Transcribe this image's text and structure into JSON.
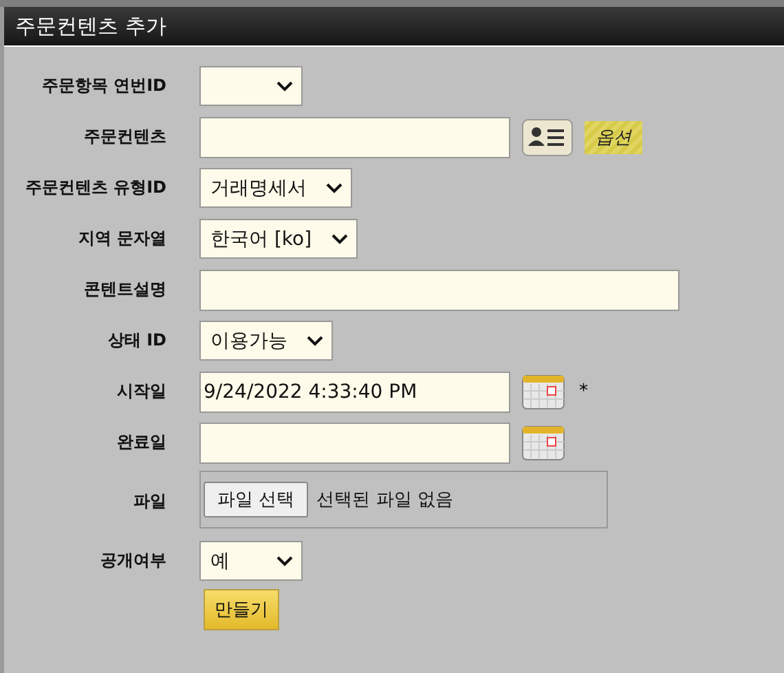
{
  "window": {
    "title": "주문컨텐츠 추가"
  },
  "fields": [
    {
      "label": "주문항목 연번ID",
      "kind": "select"
    },
    {
      "label": "주문컨텐츠",
      "kind": "text",
      "lookup": true,
      "option_tag": "옵션"
    },
    {
      "label": "주문컨텐츠 유형ID",
      "kind": "select",
      "value": "거래명세서"
    },
    {
      "label": "지역 문자열",
      "kind": "select",
      "value": "한국어 [ko]"
    },
    {
      "label": "콘텐트설명",
      "kind": "text",
      "wide": true
    },
    {
      "label": "상태 ID",
      "kind": "select",
      "value": "이용가능"
    },
    {
      "label": "시작일",
      "kind": "text",
      "value": "9/24/2022 4:33:40 PM",
      "calendar": true,
      "required_mark": "*"
    },
    {
      "label": "완료일",
      "kind": "text",
      "calendar": true
    },
    {
      "label": "파일",
      "kind": "file",
      "button": "파일 선택",
      "status": "선택된 파일 없음"
    },
    {
      "label": "공개여부",
      "kind": "select",
      "value": "예"
    }
  ],
  "submit": "만들기"
}
